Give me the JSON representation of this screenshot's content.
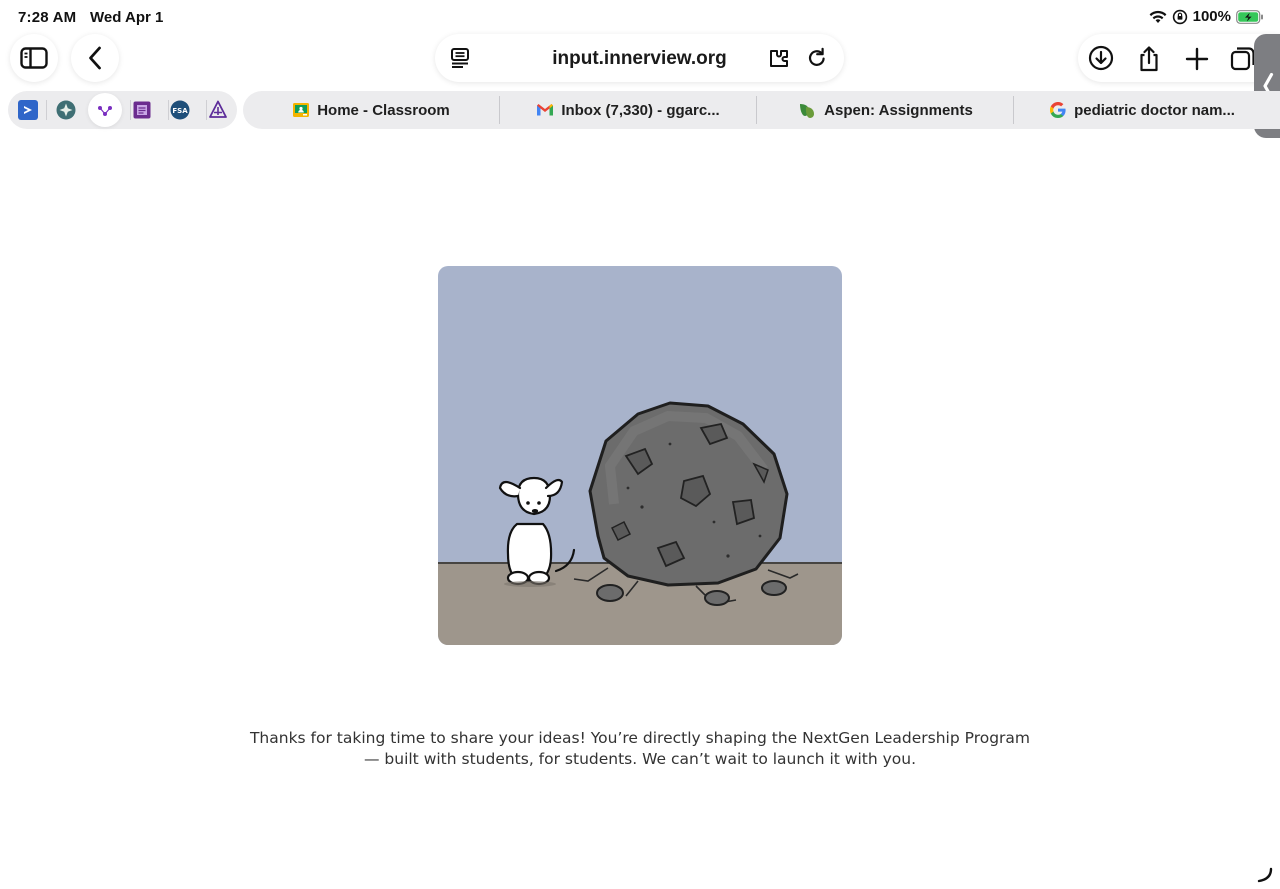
{
  "status_bar": {
    "time": "7:28 AM",
    "date": "Wed Apr 1",
    "battery": "100%"
  },
  "toolbar": {
    "url": "input.innerview.org",
    "icons": {
      "sidebar": "sidebar-icon",
      "back": "chevron-left-icon",
      "reader": "reader-icon",
      "extensions": "extension-icon",
      "reload": "reload-icon",
      "downloads": "download-icon",
      "share": "share-icon",
      "new_tab": "plus-icon",
      "tabs": "tabs-overview-icon"
    }
  },
  "favorites": [
    {
      "name": "favorite-1",
      "color": "#2f66c9"
    },
    {
      "name": "favorite-2",
      "color": "#3f6f74"
    },
    {
      "name": "favorite-3",
      "color": "#7a2fc0"
    },
    {
      "name": "favorite-4",
      "color": "#6b2c8f"
    },
    {
      "name": "favorite-5-fsa",
      "color": "#1f4f7a",
      "text": "FSA"
    },
    {
      "name": "favorite-6",
      "color": "#5d2d9a"
    }
  ],
  "tabs": [
    {
      "title": "Home - Classroom",
      "icon": "google-classroom-icon"
    },
    {
      "title": "Inbox (7,330) - ggarc...",
      "icon": "gmail-icon"
    },
    {
      "title": "Aspen: Assignments",
      "icon": "aspen-leaf-icon"
    },
    {
      "title": "pediatric doctor nam...",
      "icon": "google-icon"
    }
  ],
  "main": {
    "message": "Thanks for taking  time to share your ideas! You’re directly shaping the NextGen Leadership Program — built with students, for students. We can’t wait to launch it with you."
  },
  "colors": {
    "sky": "#a8b3cb",
    "ground": "#9e968c",
    "rock": "#6c6c6c"
  }
}
